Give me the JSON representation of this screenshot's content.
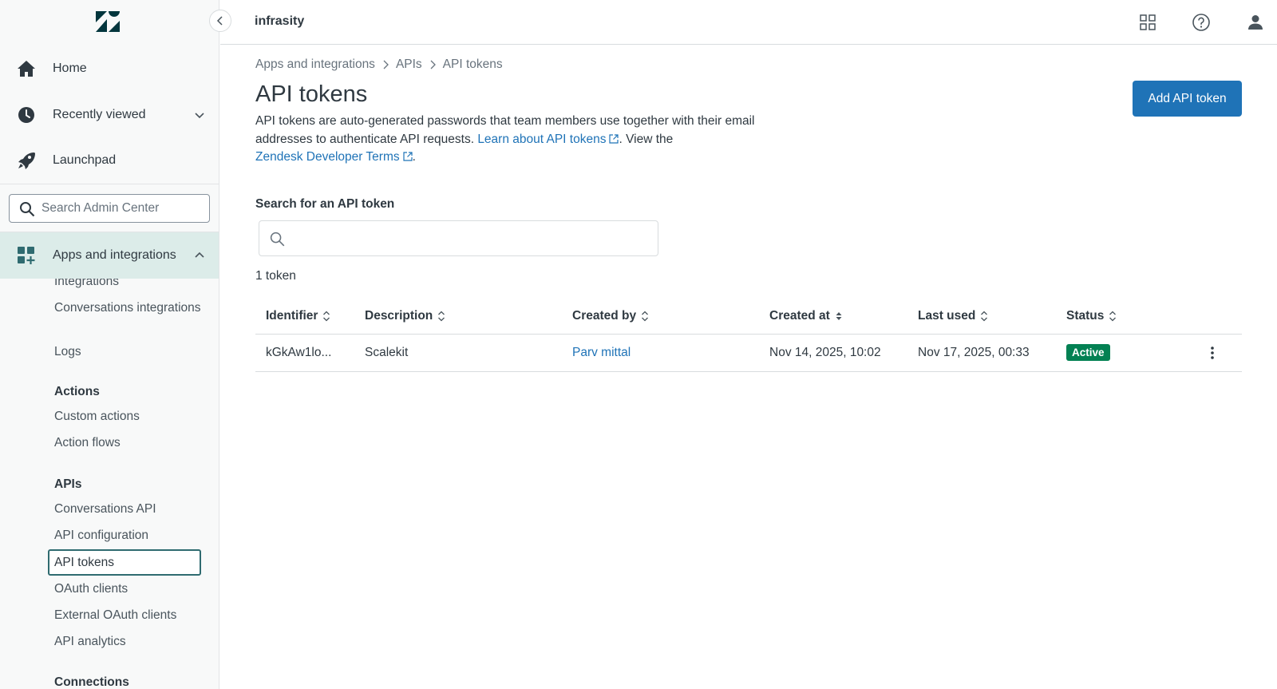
{
  "sidebar": {
    "logo_icon": "zendesk-logo",
    "collapse_icon": "chevron-left-icon",
    "nav": [
      {
        "label": "Home",
        "icon": "home-icon"
      },
      {
        "label": "Recently viewed",
        "icon": "clock-icon"
      },
      {
        "label": "Launchpad",
        "icon": "rocket-icon"
      }
    ],
    "search_placeholder": "Search Admin Center",
    "active_section": {
      "label": "Apps and integrations",
      "icon": "apps-add-icon"
    },
    "links": {
      "integrations": "Integrations",
      "conversations_integrations": "Conversations integrations",
      "logs": "Logs",
      "actions_heading": "Actions",
      "custom_actions": "Custom actions",
      "action_flows": "Action flows",
      "apis_heading": "APIs",
      "conversations_api": "Conversations API",
      "api_configuration": "API configuration",
      "api_tokens": "API tokens",
      "oauth_clients": "OAuth clients",
      "external_oauth_clients": "External OAuth clients",
      "api_analytics": "API analytics",
      "connections_heading": "Connections"
    }
  },
  "topbar": {
    "org_name": "infrasity",
    "icons": [
      "products-grid-icon",
      "help-icon",
      "user-icon"
    ]
  },
  "breadcrumb": [
    "Apps and integrations",
    "APIs",
    "API tokens"
  ],
  "page": {
    "title": "API tokens",
    "intro_1": "API tokens are auto-generated passwords that team members use together with their email addresses to authenticate API requests. ",
    "learn_link": "Learn about API tokens",
    "intro_2": ". View the ",
    "terms_link": "Zendesk Developer Terms",
    "intro_3": ".",
    "add_button": "Add API token",
    "search_label": "Search for an API token",
    "search_value": "",
    "count": "1 token"
  },
  "table": {
    "columns": [
      "Identifier",
      "Description",
      "Created by",
      "Created at",
      "Last used",
      "Status"
    ],
    "rows": [
      {
        "identifier": "kGkAw1lo...",
        "description": "Scalekit",
        "created_by": "Parv mittal",
        "created_at": "Nov 14, 2025, 10:02",
        "last_used": "Nov 17, 2025, 00:33",
        "status": "Active"
      }
    ]
  },
  "colors": {
    "primary": "#1f73b7",
    "active_badge": "#038153",
    "sidebar_active": "#dcece9",
    "selected_border": "#2f6b70"
  }
}
